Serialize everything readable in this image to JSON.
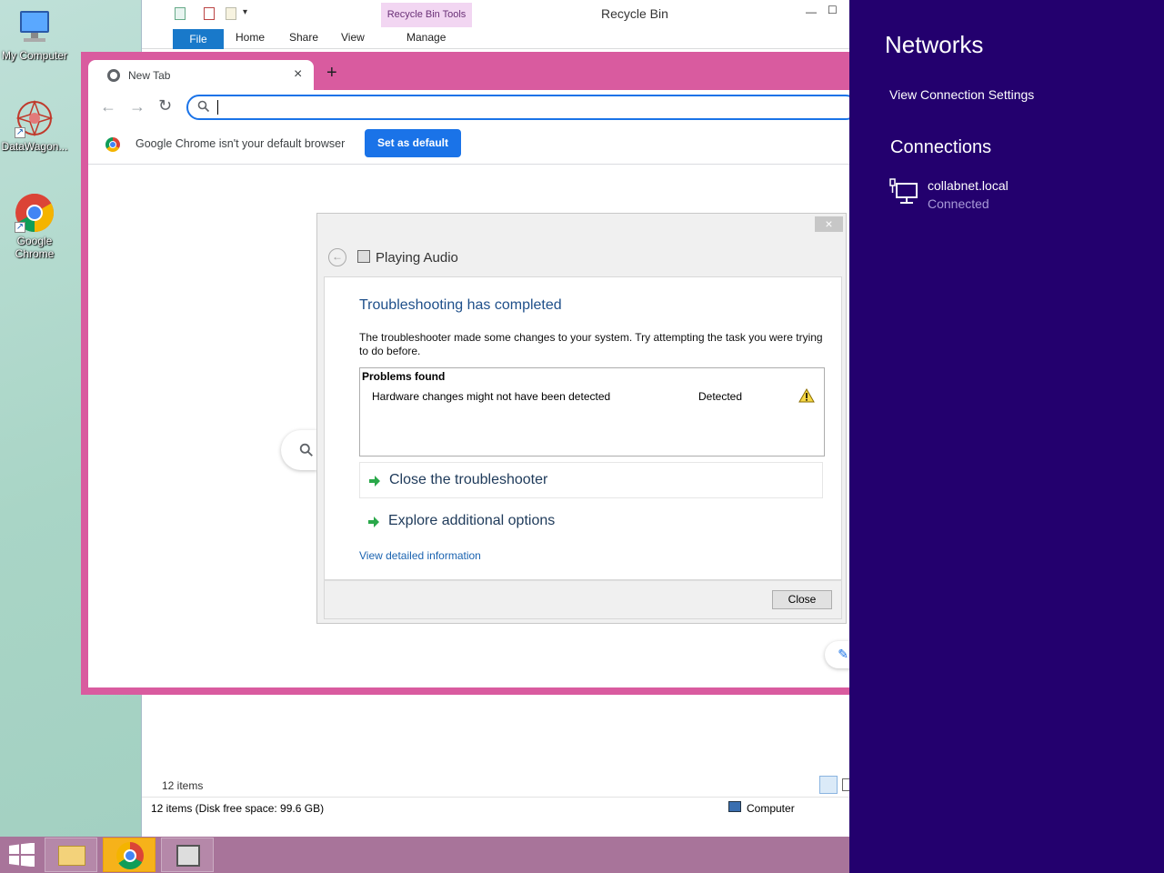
{
  "desktop": {
    "icons": [
      {
        "label": "My Computer",
        "icon": "monitor-icon"
      },
      {
        "label": "DataWagon...",
        "icon": "datawagon-icon"
      },
      {
        "label": "Google Chrome",
        "icon": "chrome-icon"
      }
    ]
  },
  "explorer": {
    "title": "Recycle Bin",
    "context_tab": "Recycle Bin Tools",
    "tabs": [
      "File",
      "Home",
      "Share",
      "View",
      "Manage"
    ],
    "item_count": "12 items",
    "status_left": "12 items (Disk free space: 99.6 GB)",
    "status_right": "Computer"
  },
  "chrome": {
    "tab_title": "New Tab",
    "omnibox_value": "",
    "infobar_text": "Google Chrome isn't your default browser",
    "set_default_label": "Set as default"
  },
  "dialog": {
    "title": "Playing Audio",
    "heading": "Troubleshooting has completed",
    "message": "The troubleshooter made some changes to your system. Try attempting the task you were trying to do before.",
    "problems_header": "Problems found",
    "problems": [
      {
        "name": "Hardware changes might not have been detected",
        "status": "Detected",
        "icon": "warning-icon"
      }
    ],
    "option_close": "Close the troubleshooter",
    "option_explore": "Explore additional options",
    "detail_link": "View detailed information",
    "close_button": "Close"
  },
  "charm": {
    "title": "Networks",
    "view_settings": "View Connection Settings",
    "connections_header": "Connections",
    "connection": {
      "name": "collabnet.local",
      "status": "Connected"
    }
  },
  "colors": {
    "charm_bg": "#23006e",
    "chrome_frame": "#d95b9f",
    "accent_blue": "#1a73e8",
    "taskbar": "#a8749a"
  }
}
